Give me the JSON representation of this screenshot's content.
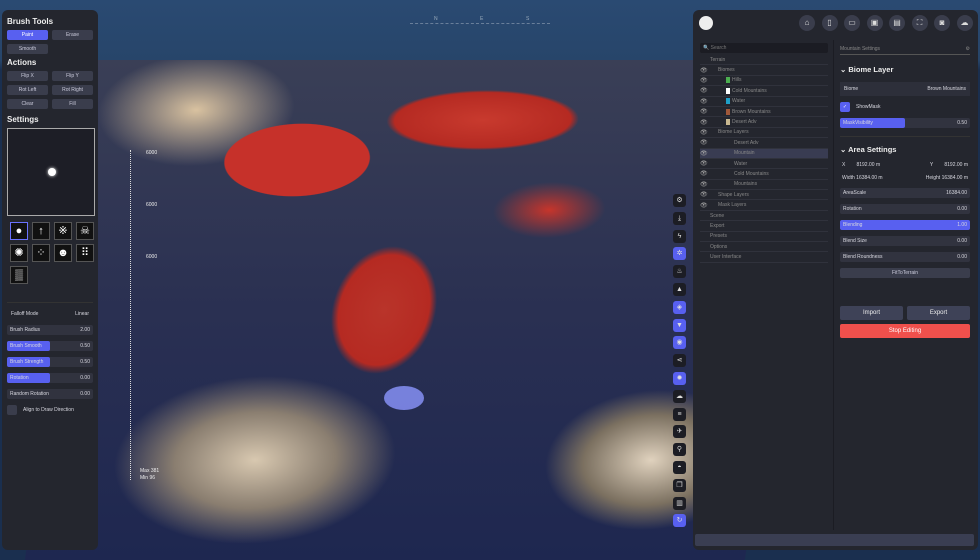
{
  "viewport": {
    "compass": [
      "N",
      "E",
      "S"
    ],
    "elevation_labels": [
      "6000",
      "6000",
      "6000"
    ],
    "stats": [
      "Max 381",
      "Min 96"
    ]
  },
  "brush_tools": {
    "title": "Brush Tools",
    "modes": [
      "Paint",
      "Erase",
      "Smooth"
    ],
    "active_mode": "Paint"
  },
  "actions": {
    "title": "Actions",
    "buttons": [
      "Flip X",
      "Flip Y",
      "Rot Left",
      "Rot Right",
      "Clear",
      "Fill"
    ]
  },
  "settings": {
    "title": "Settings",
    "brush_icons": [
      "circle-brush-icon",
      "arrow-brush-icon",
      "noise-brush-icon",
      "skull-crossbones-brush-icon",
      "radial-brush-icon",
      "scatter-brush-icon",
      "skull-brush-icon",
      "dots-grid-brush-icon",
      "texture-brush-icon"
    ],
    "falloff_label": "Falloff Mode",
    "falloff_value": "Linear",
    "sliders": [
      {
        "label": "Brush Radius",
        "value": "2.00",
        "fill": 0
      },
      {
        "label": "Brush Smooth",
        "value": "0.50",
        "fill": 0.5
      },
      {
        "label": "Brush Strength",
        "value": "0.50",
        "fill": 0.5
      },
      {
        "label": "Rotation",
        "value": "0.00",
        "fill": 0.5
      },
      {
        "label": "Random Rotation",
        "value": "0.00",
        "fill": 0
      }
    ],
    "align_label": "Align to Draw Direction"
  },
  "toolbar": {
    "icons": [
      "home-icon",
      "new-file-icon",
      "open-folder-icon",
      "save-icon",
      "save-as-icon",
      "fullscreen-icon",
      "camera-icon",
      "chat-icon"
    ]
  },
  "tree": {
    "search_placeholder": "Search",
    "items": [
      {
        "label": "Terrain",
        "indent": 0
      },
      {
        "label": "Biomes",
        "indent": 1,
        "eye": true
      },
      {
        "label": "Hills",
        "indent": 2,
        "eye": true,
        "color": "#4caf50"
      },
      {
        "label": "Cold Mountains",
        "indent": 2,
        "eye": true,
        "color": "#ffffff"
      },
      {
        "label": "Water",
        "indent": 2,
        "eye": true,
        "color": "#1fa0c8"
      },
      {
        "label": "Brown Mountains",
        "indent": 2,
        "eye": true,
        "color": "#a0583a"
      },
      {
        "label": "Desert Adv",
        "indent": 2,
        "eye": true,
        "color": "#c8b890"
      },
      {
        "label": "Biome Layers",
        "indent": 1,
        "eye": true
      },
      {
        "label": "Desert Adv",
        "indent": 3,
        "eye": true
      },
      {
        "label": "Mountain",
        "indent": 3,
        "eye": true,
        "selected": true
      },
      {
        "label": "Water",
        "indent": 3,
        "eye": true
      },
      {
        "label": "Cold Mountains",
        "indent": 3,
        "eye": true
      },
      {
        "label": "Mountains",
        "indent": 3,
        "eye": true
      },
      {
        "label": "Shape Layers",
        "indent": 1,
        "eye": true
      },
      {
        "label": "Mask Layers",
        "indent": 1,
        "eye": true
      },
      {
        "label": "Scene",
        "indent": 0
      },
      {
        "label": "Export",
        "indent": 0
      },
      {
        "label": "Presets",
        "indent": 0
      },
      {
        "label": "Options",
        "indent": 0
      },
      {
        "label": "User Interface",
        "indent": 0
      }
    ]
  },
  "inspector": {
    "header": "Mountain Settings",
    "biome_layer_title": "Biome Layer",
    "biome_label": "Biome",
    "biome_value": "Brown Mountains",
    "show_mask": "ShowMask",
    "mask_visibility": {
      "label": "MaskVisibility",
      "value": "0.50",
      "fill": 0.5
    },
    "area_title": "Area Settings",
    "x_label": "X",
    "x": "8192.00",
    "y_label": "Y",
    "y": "8192.00",
    "unit": "m",
    "width_label": "Width",
    "width": "16384.00",
    "height_label": "Height",
    "height": "16384.00",
    "sliders": [
      {
        "label": "AreaScale",
        "value": "16384.00",
        "fill": 0
      },
      {
        "label": "Rotation",
        "value": "0.00",
        "fill": 0
      },
      {
        "label": "Blending",
        "value": "1.00",
        "fill": 1
      },
      {
        "label": "Blend Size",
        "value": "0.00",
        "fill": 0
      },
      {
        "label": "Blend Roundness",
        "value": "0.00",
        "fill": 0
      }
    ],
    "fit": "FitToTerrain",
    "import": "Import",
    "export": "Export",
    "stop": "Stop Editing"
  },
  "vertical_tools": [
    "gear-icon",
    "download-icon",
    "lightning-icon",
    "settings-sliders-icon",
    "fire-icon",
    "mountain-icon",
    "layers-icon",
    "filter-icon",
    "eye-icon",
    "share-icon",
    "sun-icon",
    "cloud-icon",
    "lines-icon",
    "plane-icon",
    "person-icon",
    "dome-icon",
    "copy-icon",
    "chart-icon",
    "refresh-icon"
  ],
  "colors": {
    "accent": "#5860f0",
    "stop": "#f0504c",
    "panel": "#24262e"
  }
}
